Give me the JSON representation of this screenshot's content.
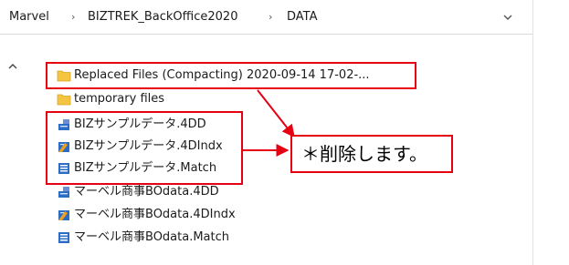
{
  "breadcrumb": {
    "items": [
      "Marvel",
      "BIZTREK_BackOffice2020",
      "DATA"
    ],
    "separator": "›"
  },
  "files": [
    {
      "name": "Replaced Files (Compacting) 2020-09-14 17-02-...",
      "icon": "folder-icon"
    },
    {
      "name": "temporary files",
      "icon": "folder-icon"
    },
    {
      "name": "BIZサンプルデータ.4DD",
      "icon": "4dd-file-icon"
    },
    {
      "name": "BIZサンプルデータ.4DIndx",
      "icon": "4dindx-file-icon"
    },
    {
      "name": "BIZサンプルデータ.Match",
      "icon": "match-file-icon"
    },
    {
      "name": "マーベル商事BOdata.4DD",
      "icon": "4dd-file-icon"
    },
    {
      "name": "マーベル商事BOdata.4DIndx",
      "icon": "4dindx-file-icon"
    },
    {
      "name": "マーベル商事BOdata.Match",
      "icon": "match-file-icon"
    }
  ],
  "annotation": {
    "text": "＊削除します。"
  },
  "colors": {
    "highlight": "#e60012",
    "folder": "#f5c542",
    "file_blue": "#2b6cc4"
  }
}
